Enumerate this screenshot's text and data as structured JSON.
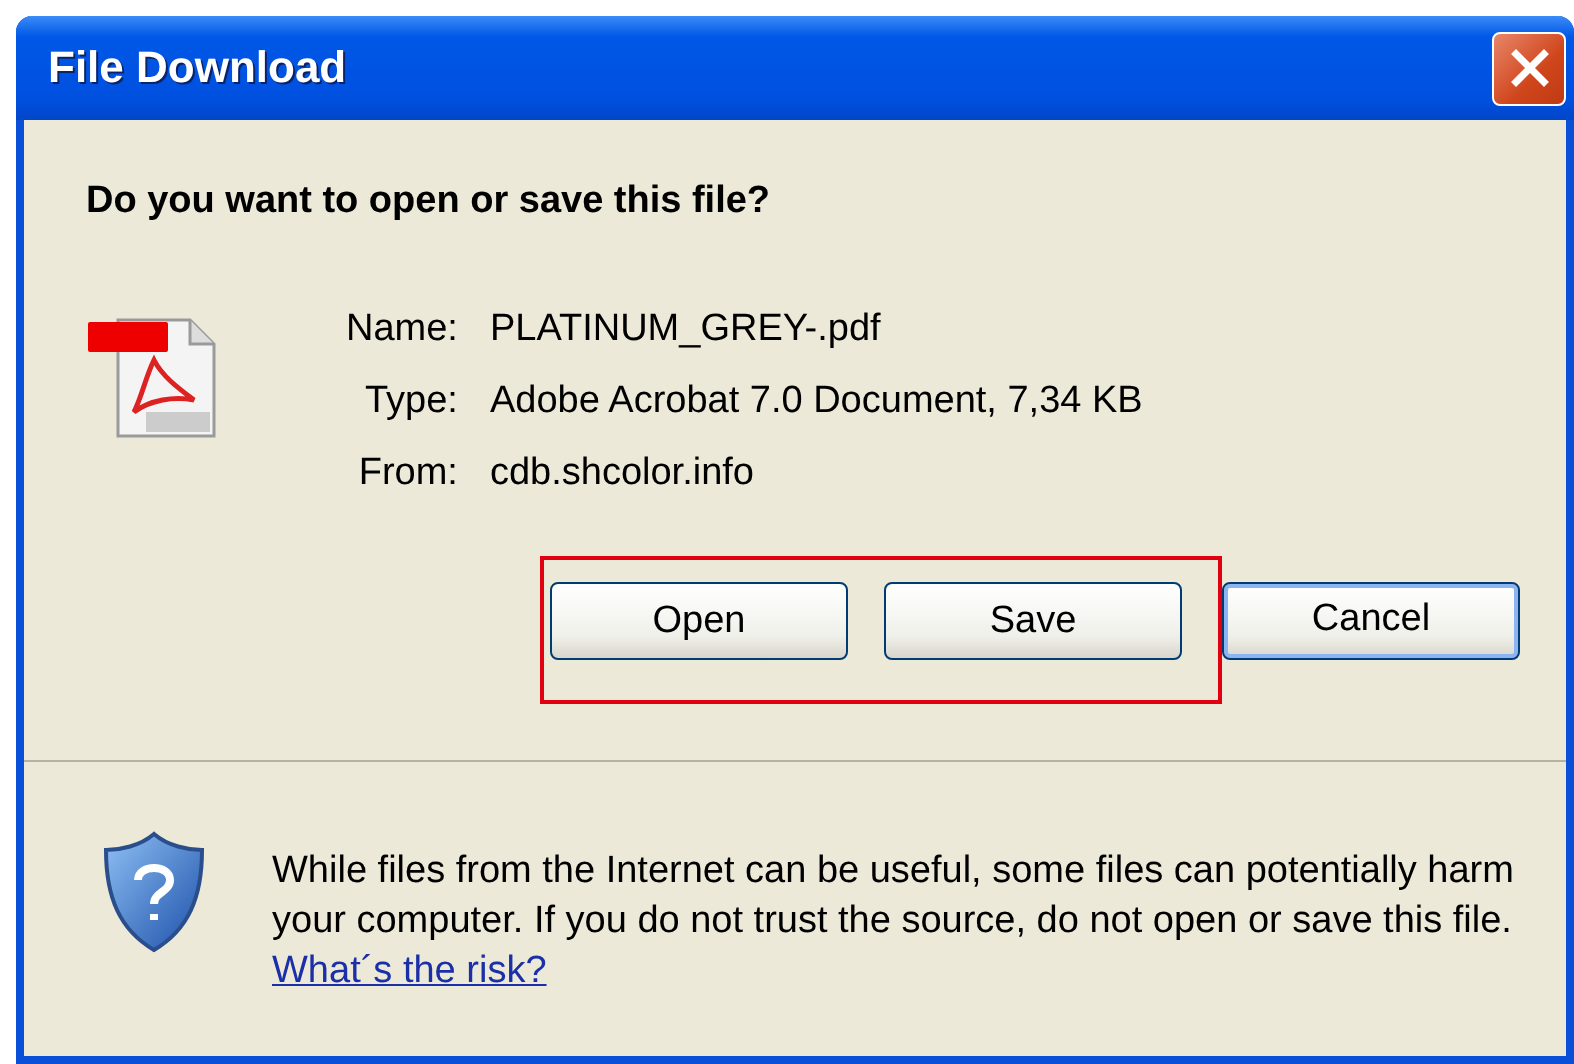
{
  "window": {
    "title": "File Download"
  },
  "question": "Do you want to open or save this file?",
  "file_info": [
    {
      "label": "Name:",
      "value": "PLATINUM_GREY-.pdf"
    },
    {
      "label": "Type:",
      "value": "Adobe Acrobat 7.0 Document, 7,34 KB"
    },
    {
      "label": "From:",
      "value": "cdb.shcolor.info"
    }
  ],
  "buttons": [
    {
      "label": "Open",
      "highlighted": true,
      "default": false
    },
    {
      "label": "Save",
      "highlighted": true,
      "default": false
    },
    {
      "label": "Cancel",
      "highlighted": false,
      "default": true
    }
  ],
  "warning": {
    "text": "While files from the Internet can be useful, some files can potentially harm your computer. If you do not trust the source, do not open or save this file.",
    "link": "What´s the risk?"
  }
}
